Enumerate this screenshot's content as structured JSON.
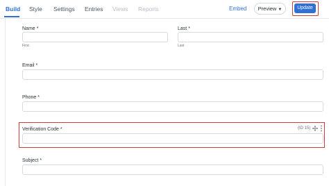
{
  "header": {
    "tabs": [
      {
        "label": "Build"
      },
      {
        "label": "Style"
      },
      {
        "label": "Settings"
      },
      {
        "label": "Entries"
      },
      {
        "label": "Views"
      },
      {
        "label": "Reports"
      }
    ],
    "embed_label": "Embed",
    "preview_label": "Preview",
    "update_label": "Update"
  },
  "form": {
    "name_label": "Name",
    "first_sublabel": "First",
    "last_label": "Last",
    "last_sublabel": "Last",
    "email_label": "Email",
    "phone_label": "Phone",
    "verification_label": "Verification Code",
    "verification_id": "(ID 15)",
    "subject_label": "Subject",
    "required_marker": "*"
  },
  "icons": {
    "preview_chevron": "chevron-down-icon",
    "move": "move-arrows-icon",
    "more": "vertical-dots-icon"
  },
  "colors": {
    "accent": "#2f6fd6",
    "highlight": "#d33a3a",
    "disabled": "#b9bec6"
  }
}
